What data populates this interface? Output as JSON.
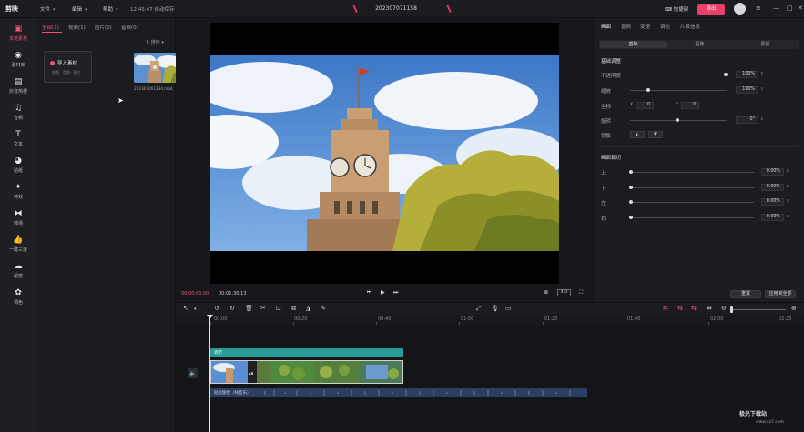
{
  "topbar": {
    "logo": "剪映",
    "menus": [
      "文件",
      "编辑",
      "帮助"
    ],
    "autosave": "12:45:47 自动保存",
    "project_title": "202307071158",
    "shortcut": "快捷键",
    "export": "导出"
  },
  "leftnav": [
    {
      "label": "本地素材",
      "icon": "folder-icon"
    },
    {
      "label": "素材库",
      "icon": "library-icon"
    },
    {
      "label": "抖音热梗",
      "icon": "trend-icon"
    },
    {
      "label": "音频",
      "icon": "music-icon"
    },
    {
      "label": "文本",
      "icon": "text-icon"
    },
    {
      "label": "贴纸",
      "icon": "sticker-icon"
    },
    {
      "label": "特效",
      "icon": "effect-icon"
    },
    {
      "label": "转场",
      "icon": "transition-icon"
    },
    {
      "label": "一键三连",
      "icon": "thumb-icon"
    },
    {
      "label": "滤镜",
      "icon": "filter-icon"
    },
    {
      "label": "调色",
      "icon": "palette-icon"
    }
  ],
  "media": {
    "tabs": [
      "全部(1)",
      "视频(1)",
      "图片(0)",
      "音频(0)"
    ],
    "sort": "排序",
    "import_title": "导入素材",
    "import_sub": "视频 · 音频 · 图片",
    "file_name": "202307061234.mp4"
  },
  "preview": {
    "timecode_current": "00:00:00.00",
    "timecode_total": "00:01:30.13",
    "ratio": "4:3"
  },
  "properties": {
    "tabs": [
      "画面",
      "音频",
      "变速",
      "调色",
      "片段信息"
    ],
    "subtabs": [
      "基础",
      "抠像",
      "蒙版"
    ],
    "section_basic": "基础调整",
    "opacity_label": "不透明度",
    "opacity_value": "100%",
    "scale_label": "缩放",
    "scale_value": "100%",
    "position_label": "坐标",
    "position_x": "0",
    "position_y": "0",
    "rotation_label": "旋转",
    "rotation_value": "0°",
    "mirror_label": "镜像",
    "section_crop": "画面裁切",
    "crop": [
      {
        "label": "上",
        "value": "0.00%"
      },
      {
        "label": "下",
        "value": "0.00%"
      },
      {
        "label": "左",
        "value": "0.00%"
      },
      {
        "label": "右",
        "value": "0.00%"
      }
    ],
    "reset": "重置",
    "apply_all": "应用到全部"
  },
  "timeline": {
    "ruler_labels": [
      "00:00",
      "00:20",
      "00:40",
      "01:00",
      "01:20",
      "01:40",
      "02:00",
      "02:20"
    ],
    "fx_clip": "调节",
    "audio_clip": "轻松愉悦（纯音乐）"
  },
  "watermark": {
    "title": "极光下载站",
    "url": "www.xz7.com"
  },
  "colors": {
    "accent": "#ef5178",
    "fx_clip": "#2b9b97",
    "audio_clip": "#2c3e62"
  }
}
